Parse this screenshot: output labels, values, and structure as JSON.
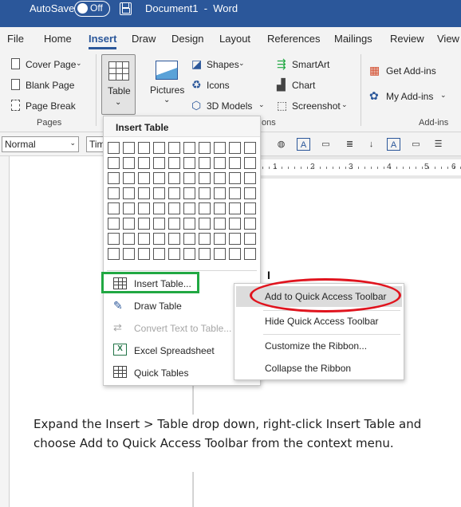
{
  "titlebar": {
    "autosave_label": "AutoSave",
    "toggle_state": "Off",
    "document_title": "Document1  -  Word"
  },
  "tabs": [
    "File",
    "Home",
    "Insert",
    "Draw",
    "Design",
    "Layout",
    "References",
    "Mailings",
    "Review",
    "View"
  ],
  "active_tab": "Insert",
  "ribbon": {
    "pages": {
      "items": [
        "Cover Page",
        "Blank Page",
        "Page Break"
      ],
      "label": "Pages"
    },
    "table_button": "Table",
    "pictures_button": "Pictures",
    "illustrations": [
      "Shapes",
      "Icons",
      "3D Models"
    ],
    "illustrations_right": [
      "SmartArt",
      "Chart",
      "Screenshot"
    ],
    "group_label_partial": "ons",
    "addins": {
      "items": [
        "Get Add-ins",
        "My Add-ins"
      ],
      "label": "Add-ins"
    }
  },
  "format_strip": {
    "style_value": "Normal",
    "font_value": "Tim"
  },
  "ruler_numbers": [
    "1",
    "2",
    "3",
    "4",
    "5",
    "6"
  ],
  "insert_table_menu": {
    "title": "Insert Table",
    "grid_columns": 10,
    "grid_rows": 8,
    "items": [
      {
        "label": "Insert Table...",
        "icon": "table-icon",
        "enabled": true
      },
      {
        "label": "Draw Table",
        "icon": "pencil-table-icon",
        "enabled": true
      },
      {
        "label": "Convert Text to Table...",
        "icon": "convert-text-icon",
        "enabled": false
      },
      {
        "label": "Excel Spreadsheet",
        "icon": "excel-icon",
        "enabled": true
      },
      {
        "label": "Quick Tables",
        "icon": "table-icon",
        "enabled": true
      }
    ]
  },
  "context_menu": {
    "items": [
      "Add to Quick Access Toolbar",
      "Hide Quick Access Toolbar",
      "Customize the Ribbon...",
      "Collapse the Ribbon"
    ],
    "highlighted": "Add to Quick Access Toolbar"
  },
  "caption": "Expand the Insert > Table drop down, right-click Insert Table and choose Add to Quick Access Toolbar from the context menu.",
  "colors": {
    "titlebar": "#2b579a",
    "highlight_box": "#21a843",
    "annotation_ellipse": "#e0141e"
  }
}
